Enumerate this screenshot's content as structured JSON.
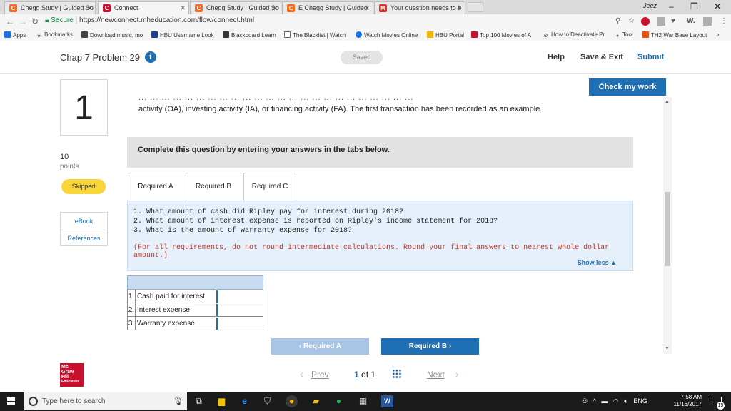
{
  "browser": {
    "tabs": [
      {
        "title": "Chegg Study | Guided So",
        "favicon": "C",
        "color": "#f26b21"
      },
      {
        "title": "Connect",
        "favicon": "C",
        "color": "#c8102e"
      },
      {
        "title": "Chegg Study | Guided So",
        "favicon": "C",
        "color": "#f26b21"
      },
      {
        "title": "E Chegg Study | Guided",
        "favicon": "C",
        "color": "#f26b21"
      },
      {
        "title": "Your question needs to b",
        "favicon": "M",
        "color": "#d93025"
      }
    ],
    "profile_name": "Jeez",
    "url_secure": "Secure",
    "url": "https://newconnect.mheducation.com/flow/connect.html",
    "bookmarks": [
      "Apps",
      "Bookmarks",
      "Download music, mo",
      "HBU Username Look",
      "Blackboard Learn",
      "The Blacklist | Watch",
      "Watch Movies Online",
      "HBU Portal",
      "Top 100 Movies of A",
      "How to Deactivate Pr",
      "Tool",
      "TH2 War Base Layout"
    ]
  },
  "header": {
    "title": "Chap 7 Problem 29",
    "info_glyph": "i",
    "saved": "Saved",
    "help": "Help",
    "save_exit": "Save & Exit",
    "submit": "Submit"
  },
  "question": {
    "number": "1",
    "points_value": "10",
    "points_label": "points",
    "status": "Skipped",
    "ebook": "eBook",
    "references": "References",
    "check_my_work": "Check my work",
    "cut_line": "... ... ... ... ... ... ... ... ... ... ... ... ... ... ... ... ... ... ... ... ... ... ... ...",
    "instruction": "activity (OA), investing activity (IA), or financing activity (FA). The first transaction has been recorded as an example.",
    "complete_banner": "Complete this question by entering your answers in the tabs below.",
    "tabs": [
      "Required A",
      "Required B",
      "Required C"
    ],
    "lines": [
      "1. What amount of cash did Ripley pay for interest during 2018?",
      "2. What amount of interest expense is reported on Ripley's income statement for 2018?",
      "3. What is the amount of warranty expense for 2018?"
    ],
    "note": "(For all requirements, do not round intermediate calculations. Round your final answers to nearest whole dollar amount.)",
    "show_less": "Show less ▲",
    "rows": [
      {
        "num": "1.",
        "label": "Cash paid for interest",
        "value": ""
      },
      {
        "num": "2.",
        "label": "Interest expense",
        "value": ""
      },
      {
        "num": "3.",
        "label": "Warranty expense",
        "value": ""
      }
    ],
    "prev_tab_btn": "‹  Required A",
    "next_tab_btn": "Required B  ›"
  },
  "footer": {
    "logo_lines": [
      "Mc",
      "Graw",
      "Hill",
      "Education"
    ],
    "prev": "Prev",
    "page_current": "1",
    "page_of": "of 1",
    "next": "Next"
  },
  "taskbar": {
    "search_placeholder": "Type here to search",
    "language": "ENG",
    "time": "7:58 AM",
    "date": "11/16/2017",
    "notification_count": "19"
  }
}
